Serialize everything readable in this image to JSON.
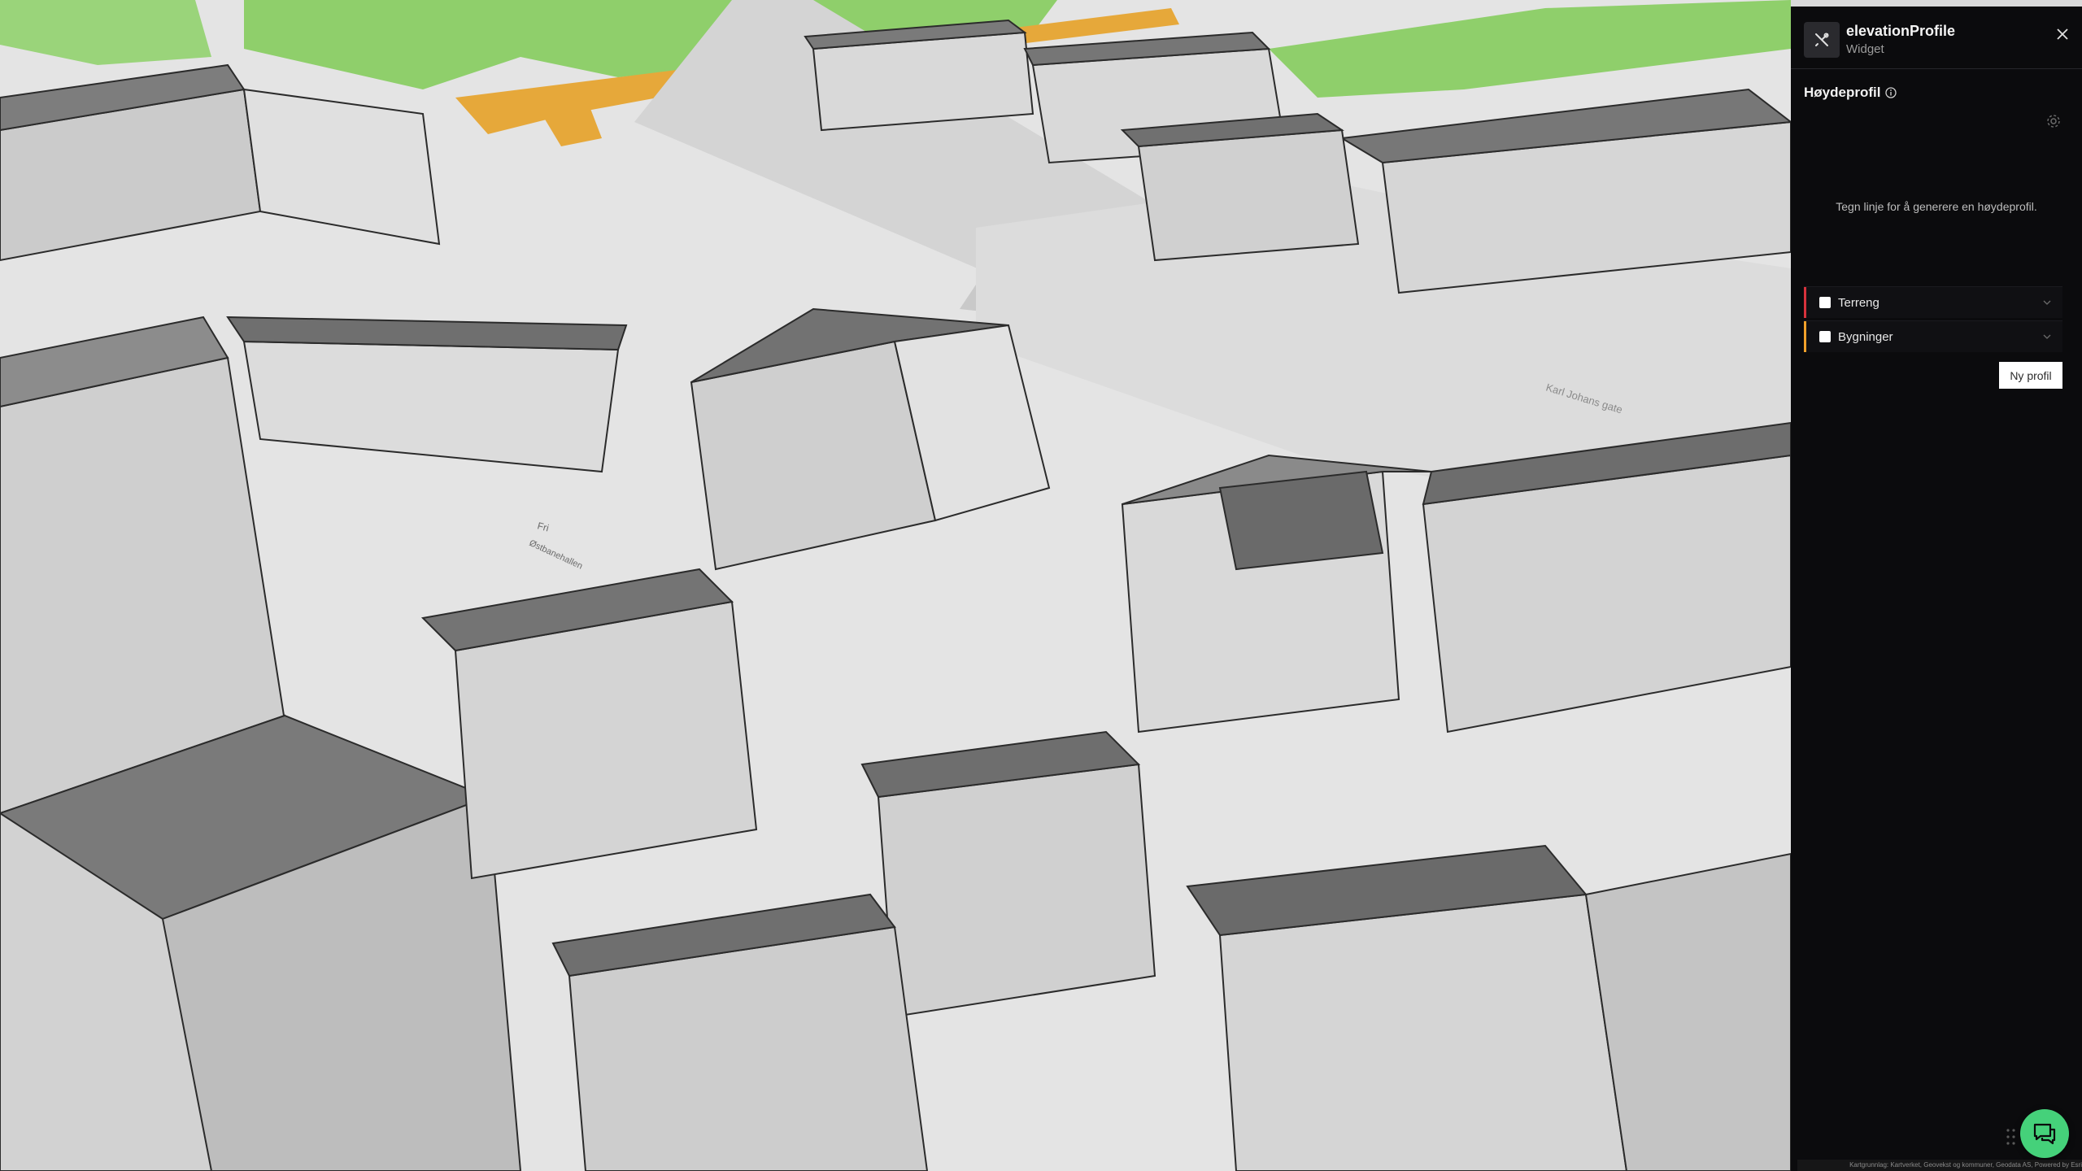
{
  "colors": {
    "panel_bg": "#0b0b0d",
    "accent_terrain": "#d8323c",
    "accent_buildings": "#f0a02a",
    "chat_button": "#45d17a",
    "park_green": "#8fcf6b",
    "road_orange": "#e6a83a"
  },
  "widget": {
    "title": "elevationProfile",
    "subtitle": "Widget",
    "icon": "tools-icon",
    "close_icon": "close-icon"
  },
  "profile": {
    "title": "Høydeprofil",
    "info_icon": "info-icon",
    "settings_icon": "gear-icon",
    "hint": "Tegn linje for å generere en høydeprofil.",
    "layers": [
      {
        "label": "Terreng",
        "checked": false,
        "color": "#d8323c"
      },
      {
        "label": "Bygninger",
        "checked": false,
        "color": "#f0a02a"
      }
    ],
    "new_button": "Ny profil"
  },
  "map": {
    "street_label": "Karl Johans gate",
    "square_label_1": "Fri",
    "square_label_2": "Østbanehallen"
  },
  "chat": {
    "icon": "chat-icon"
  },
  "attribution": "Kartgrunnlag: Kartverket, Geovekst og kommuner, Geodata AS, Powered by Esri"
}
